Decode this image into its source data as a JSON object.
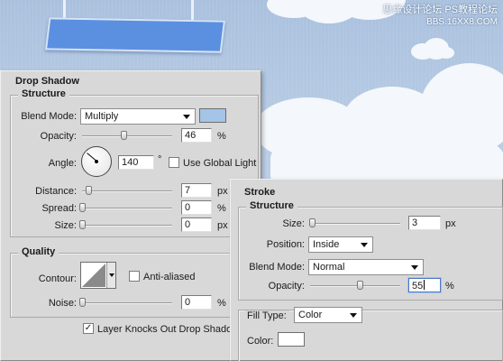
{
  "watermark": {
    "line1": "思缘设计论坛  PS教程论坛",
    "line2": "BBS.16XX8.COM"
  },
  "drop_shadow": {
    "title": "Drop Shadow",
    "structure": {
      "title": "Structure",
      "blend_mode_label": "Blend Mode:",
      "blend_mode_value": "Multiply",
      "shadow_color": "#a4c4e8",
      "opacity_label": "Opacity:",
      "opacity_value": "46",
      "opacity_unit": "%",
      "opacity_level": 0.46,
      "angle_label": "Angle:",
      "angle_value": "140",
      "angle_unit": "°",
      "use_global_light_label": "Use Global Light",
      "use_global_light_checked": false,
      "distance_label": "Distance:",
      "distance_value": "7",
      "distance_unit": "px",
      "distance_level": 0.07,
      "spread_label": "Spread:",
      "spread_value": "0",
      "spread_unit": "%",
      "spread_level": 0.0,
      "size_label": "Size:",
      "size_value": "0",
      "size_unit": "px",
      "size_level": 0.0
    },
    "quality": {
      "title": "Quality",
      "contour_label": "Contour:",
      "anti_aliased_label": "Anti-aliased",
      "anti_aliased_checked": false,
      "noise_label": "Noise:",
      "noise_value": "0",
      "noise_unit": "%",
      "noise_level": 0.0
    },
    "knockout_label": "Layer Knocks Out Drop Shadow",
    "knockout_checked": true
  },
  "stroke": {
    "title": "Stroke",
    "structure": {
      "title": "Structure",
      "size_label": "Size:",
      "size_value": "3",
      "size_unit": "px",
      "size_level": 0.02,
      "position_label": "Position:",
      "position_value": "Inside",
      "blend_mode_label": "Blend Mode:",
      "blend_mode_value": "Normal",
      "opacity_label": "Opacity:",
      "opacity_value": "55",
      "opacity_unit": "%",
      "opacity_level": 0.55
    },
    "fill_type_label": "Fill Type:",
    "fill_type_value": "Color",
    "color_label": "Color:",
    "color_value": "#ffffff"
  }
}
